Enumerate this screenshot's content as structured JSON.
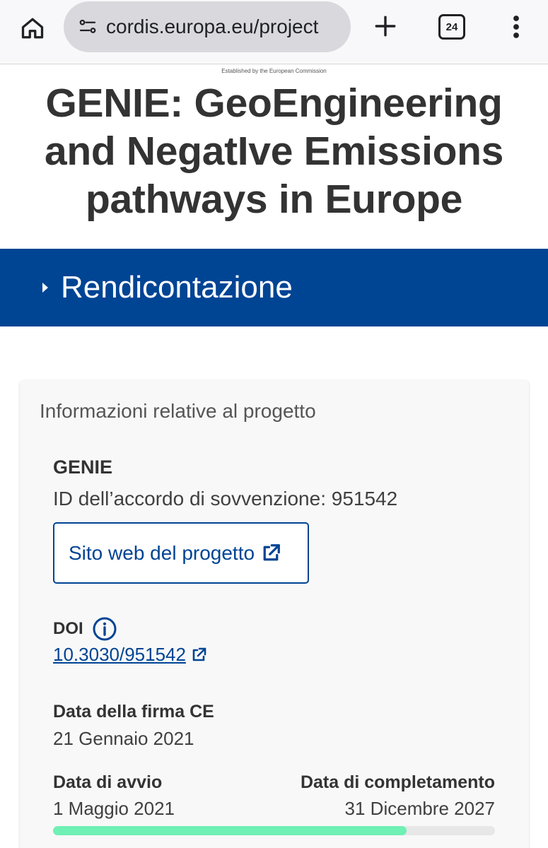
{
  "browser": {
    "url": "cordis.europa.eu/project",
    "tab_count": "24",
    "icons": [
      "home-icon",
      "site-settings-icon",
      "new-tab-icon",
      "tab-switcher-icon",
      "more-menu-icon"
    ]
  },
  "header": {
    "established": "Established by the European Commission",
    "title": "GENIE: GeoEngineering and NegatIve Emissions pathways in Europe"
  },
  "banner": {
    "label": "Rendicontazione",
    "color": "#004494"
  },
  "project_info": {
    "heading": "Informazioni relative al progetto",
    "acronym": "GENIE",
    "grant_id": "ID dell’accordo di sovvenzione: 951542",
    "website_button": "Sito web del progetto",
    "doi_label": "DOI",
    "doi_value": "10.3030/951542",
    "signature_label": "Data della firma CE",
    "signature_date": "21 Gennaio 2021",
    "start_label": "Data di avvio",
    "start_date": "1 Maggio 2021",
    "end_label": "Data di completamento",
    "end_date": "31 Dicembre 2027",
    "progress_fraction": 0.8,
    "progress_color": "#6ff0b5",
    "link_color": "#004494"
  }
}
